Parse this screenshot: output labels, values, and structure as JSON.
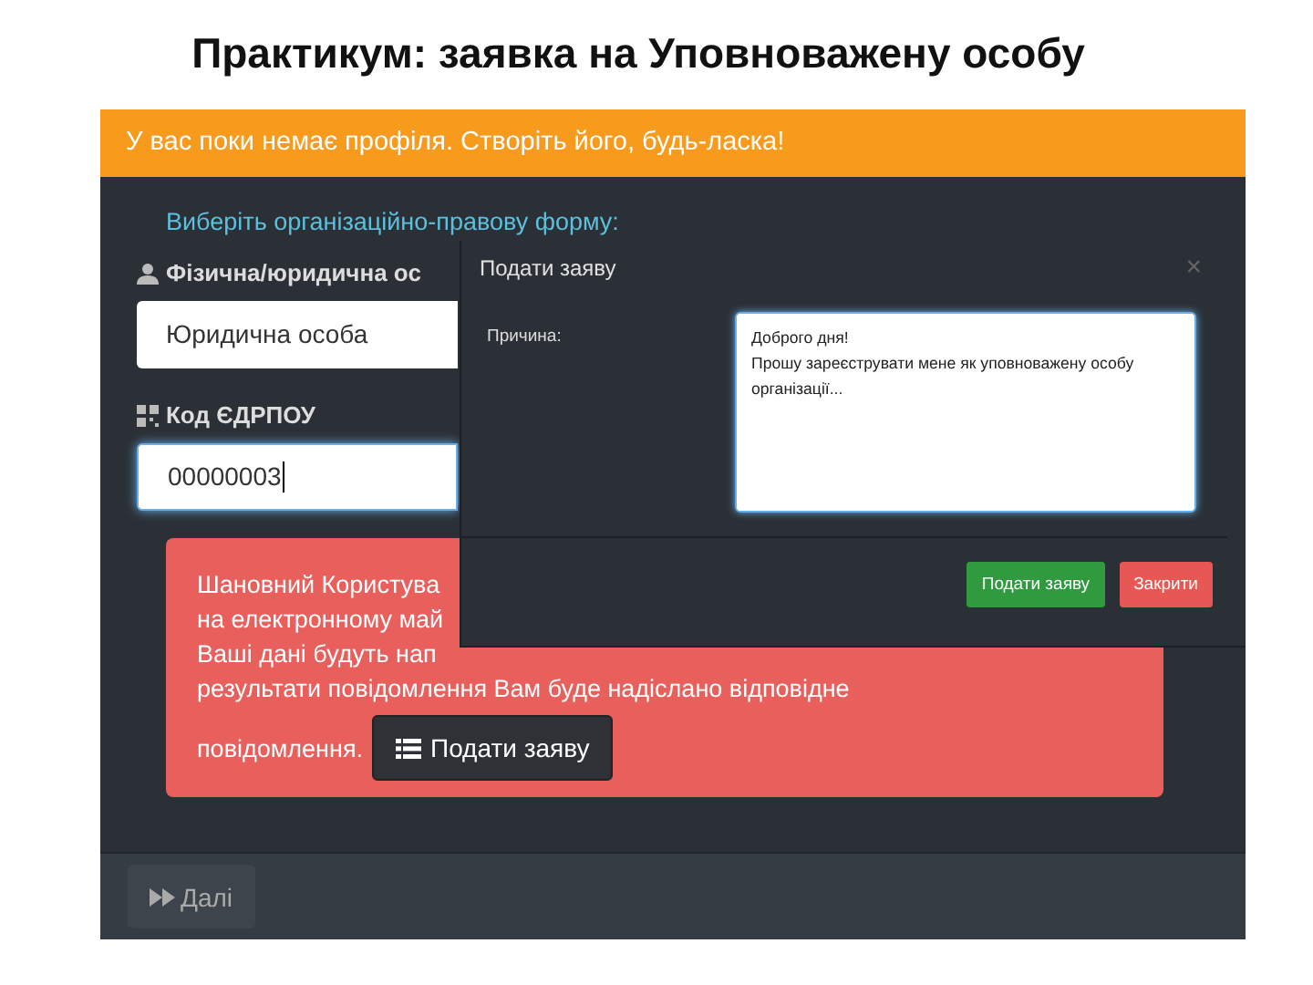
{
  "slide_title": "Практикум: заявка на Уповноважену особу",
  "banner": "У вас поки немає профіля. Створіть його, будь-ласка!",
  "form": {
    "heading": "Виберіть організаційно-правову форму:",
    "legal_form_label": "Фізична/юридична ос",
    "legal_form_value": "Юридична особа",
    "edrpou_label": "Код ЄДРПОУ",
    "edrpou_value": "00000003",
    "edrpou_focused": true
  },
  "alert": {
    "lines": [
      "Шановний Користува",
      "на електронному май",
      "Ваші дані будуть нап",
      "результати повідомлення Вам буде надіслано відповідне"
    ],
    "closing_text": "повідомлення.",
    "button": "Подати заяву"
  },
  "footer": {
    "next_button": "Далі"
  },
  "modal": {
    "title": "Подати заяву",
    "close": "×",
    "reason_label": "Причина:",
    "reason_value": "Доброго дня!\nПрошу зареєструвати мене як уповноважену особу\nорганізації...",
    "buttons": [
      {
        "label": "Подати заяву",
        "kind": "primary"
      },
      {
        "label": "Закрити",
        "kind": "danger"
      }
    ]
  }
}
